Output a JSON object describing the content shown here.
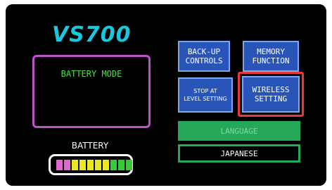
{
  "title": "VS700",
  "mode": {
    "label": "BATTERY MODE"
  },
  "battery": {
    "label": "BATTERY",
    "cell_colors": [
      "#e066d0",
      "#e066d0",
      "#e8e820",
      "#e8e820",
      "#e8e820",
      "#e8e820",
      "#e8e820",
      "#33cc33",
      "#33cc33",
      "#33cc33"
    ]
  },
  "buttons": {
    "backup_line1": "BACK-UP",
    "backup_line2": "CONTROLS",
    "memory_line1": "MEMORY",
    "memory_line2": "FUNCTION",
    "stop_line1": "STOP AT",
    "stop_line2": "LEVEL SETTING",
    "wireless_line1": "WIRELESS",
    "wireless_line2": "SETTING"
  },
  "language": {
    "button_label": "LANGUAGE",
    "current": "JAPANESE"
  },
  "colors": {
    "title": "#18c8dc",
    "mode_border": "#c050c8",
    "mode_text": "#4ee04e",
    "button_blue": "#2a55b8",
    "highlight_red": "#e53a3a",
    "language_green": "#25a85a"
  }
}
